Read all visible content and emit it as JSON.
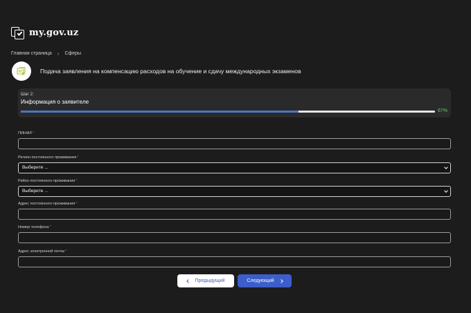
{
  "header": {
    "logo_text": "my.gov.uz",
    "logo_icon": "checkbox-document-icon"
  },
  "breadcrumb": {
    "home": "Главная страница",
    "separator": "›",
    "current": "Сферы"
  },
  "service": {
    "icon": "certificate-icon",
    "title": "Подача заявления на компенсацию расходов на обучение и сдачу международных экзаменов"
  },
  "step": {
    "number": "Шаг 2:",
    "name": "Информация о заявителе",
    "progress_percent": 67,
    "progress_label": "67%"
  },
  "fields": {
    "pinfl": {
      "label": "ПИНФЛ",
      "required": "*",
      "value": ""
    },
    "region": {
      "label": "Регион постоянного проживания",
      "required": "*",
      "value": "Выберите ..."
    },
    "district": {
      "label": "Район постоянного проживания",
      "required": "*",
      "value": "Выберите ..."
    },
    "address": {
      "label": "Адрес постоянного проживания",
      "required": "*",
      "value": ""
    },
    "phone": {
      "label": "Номер телефона",
      "required": "*",
      "value": ""
    },
    "email": {
      "label": "Адрес электронной почты",
      "required": "*",
      "value": ""
    }
  },
  "buttons": {
    "prev": "Предыдущий",
    "next": "Следующий"
  },
  "colors": {
    "accent": "#3b5ec9",
    "progress": "#4d75c8",
    "success": "#5fcf6a",
    "required": "#c95a5a"
  }
}
